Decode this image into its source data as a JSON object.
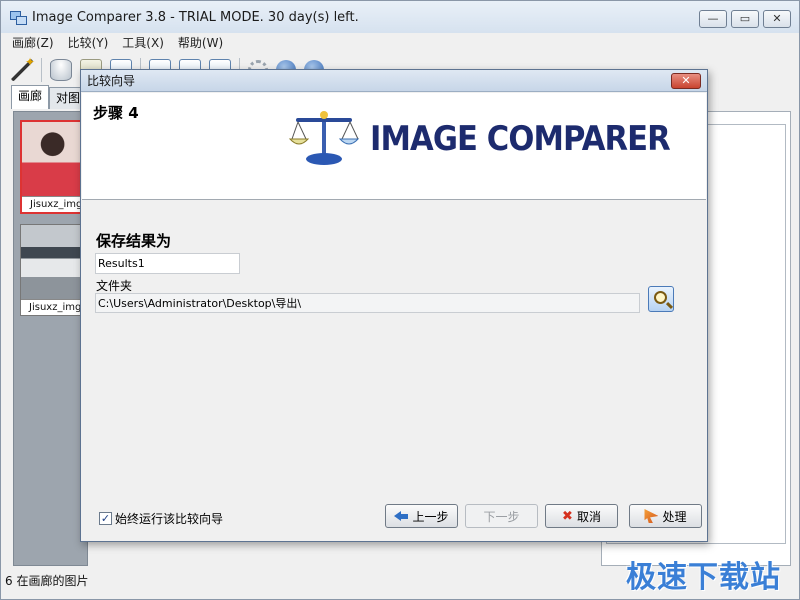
{
  "window": {
    "title": "Image Comparer 3.8 - TRIAL MODE. 30 day(s) left.",
    "minimize": "—",
    "maximize": "▭",
    "close": "✕"
  },
  "menu": [
    "画廊(Z)",
    "比较(Y)",
    "工具(X)",
    "帮助(W)"
  ],
  "tabs": [
    {
      "label": "画廊",
      "active": true
    },
    {
      "label": "对图",
      "active": false
    }
  ],
  "gallery": {
    "items": [
      {
        "label": "Jisuxz_img",
        "selected": true
      },
      {
        "label": "Jisuxz_img",
        "selected": false
      }
    ]
  },
  "status": "6 在画廊的图片",
  "dialog": {
    "title": "比较向导",
    "close": "✕",
    "step": "步骤 4",
    "logo": "IMAGE COMPARER",
    "save_heading": "保存结果为",
    "result_name": "Results1",
    "folder_label": "文件夹",
    "folder_path": "C:\\Users\\Administrator\\Desktop\\导出\\",
    "always_run_label": "始终运行该比较向导",
    "always_run_checked": "✓",
    "buttons": {
      "prev": "上一步",
      "next": "下一步",
      "cancel": "取消",
      "process": "处理"
    }
  },
  "watermark": "极速下载站",
  "colors": {
    "accent": "#2e6fc5",
    "logo": "#1d2b6e",
    "close_red": "#c9442f",
    "watermark": "#3a7fd6"
  }
}
